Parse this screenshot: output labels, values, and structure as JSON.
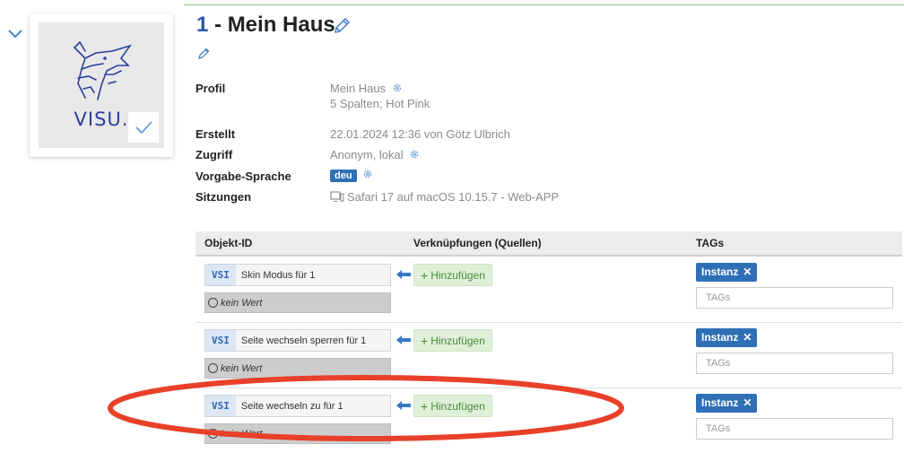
{
  "header": {
    "title_number": "1",
    "title_text": "- Mein Haus"
  },
  "logo": {
    "text": "VISU."
  },
  "info": {
    "profil_label": "Profil",
    "profil_value": "Mein Haus",
    "profil_detail": "5 Spalten; Hot Pink",
    "erstellt_label": "Erstellt",
    "erstellt_value": "22.01.2024 12:36 von Götz Ulbrich",
    "zugriff_label": "Zugriff",
    "zugriff_value": "Anonym, lokal",
    "sprache_label": "Vorgabe-Sprache",
    "sprache_value": "deu",
    "sitzungen_label": "Sitzungen",
    "sitzungen_value": "Safari 17 auf macOS 10.15.7 - Web-APP"
  },
  "table": {
    "col_objekt": "Objekt-ID",
    "col_verknuepfungen": "Verknüpfungen (Quellen)",
    "col_tags": "TAGs",
    "rows": [
      {
        "type": "VSI",
        "name": "Skin Modus für 1",
        "value": "kein Wert",
        "add_label": "Hinzufügen",
        "tag": "Instanz",
        "tags_placeholder": "TAGs"
      },
      {
        "type": "VSI",
        "name": "Seite wechseln sperren für 1",
        "value": "kein Wert",
        "add_label": "Hinzufügen",
        "tag": "Instanz",
        "tags_placeholder": "TAGs"
      },
      {
        "type": "VSI",
        "name": "Seite wechseln zu für 1",
        "value": "kein Wert",
        "add_label": "Hinzufügen",
        "tag": "Instanz",
        "tags_placeholder": "TAGs"
      }
    ]
  },
  "icons": {
    "collapse": "chevron-down-icon",
    "edit": "pencil-icon",
    "settings": "gear-icon",
    "screen": "desktop-icon",
    "link": "arrow-left-icon",
    "remove": "close-icon",
    "selected": "check-icon"
  },
  "colors": {
    "accent": "#2f6fb6",
    "add_bg": "#dff0d8",
    "add_text": "#4a8b3a",
    "annotation": "#e8402a"
  }
}
